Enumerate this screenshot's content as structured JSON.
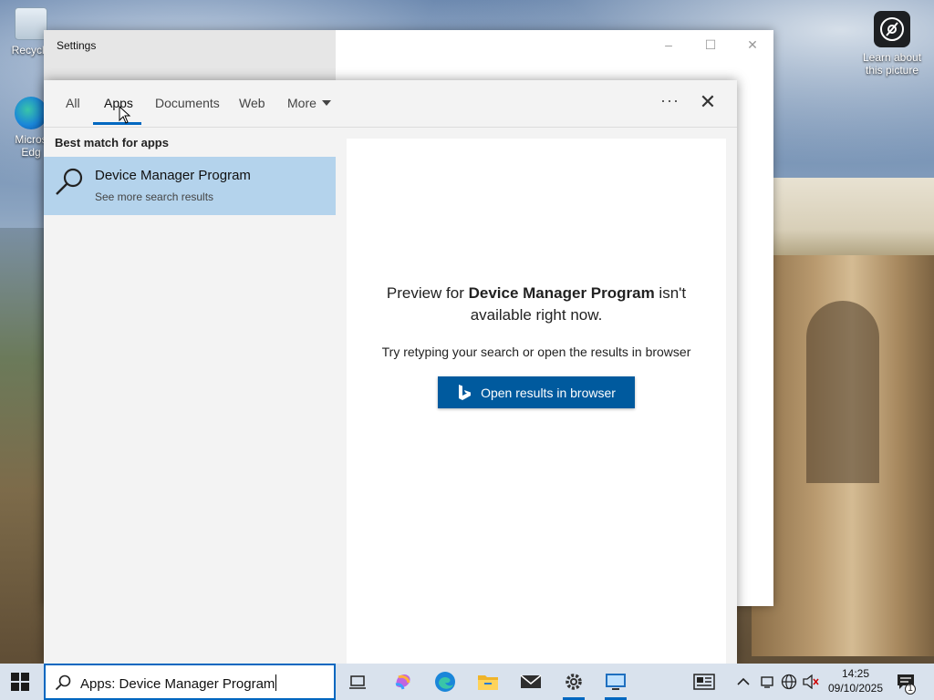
{
  "desktop": {
    "icons": [
      {
        "label": "Recycle",
        "icon": "recycle-bin-icon"
      },
      {
        "label": "Micros Edg",
        "icon": "edge-icon"
      },
      {
        "label": "Learn about this picture",
        "icon": "camera-icon"
      }
    ]
  },
  "settings_window": {
    "title": "Settings",
    "controls": {
      "minimize": "–",
      "maximize": "☐",
      "close": "✕"
    }
  },
  "search_panel": {
    "tabs": [
      {
        "label": "All"
      },
      {
        "label": "Apps",
        "active": true
      },
      {
        "label": "Documents"
      },
      {
        "label": "Web"
      },
      {
        "label": "More"
      }
    ],
    "options_label": "···",
    "close_label": "✕",
    "best_match_header": "Best match for apps",
    "best_match": {
      "title": "Device Manager Program",
      "subtitle": "See more search results"
    },
    "preview": {
      "msg_prefix": "Preview for ",
      "msg_bold": "Device Manager Program",
      "msg_suffix": " isn't available right now.",
      "hint": "Try retyping your search or open the results in browser",
      "button_label": "Open results in browser"
    }
  },
  "taskbar": {
    "search_text": "Apps: Device Manager Program",
    "pinned": [
      {
        "icon": "task-view-icon"
      },
      {
        "icon": "copilot-icon"
      },
      {
        "icon": "edge-icon"
      },
      {
        "icon": "file-explorer-icon"
      },
      {
        "icon": "mail-icon"
      },
      {
        "icon": "settings-icon",
        "active": true
      },
      {
        "icon": "remote-app-icon",
        "active": true
      }
    ],
    "clock": {
      "time": "14:25",
      "date": "09/10/2025"
    },
    "notification_count": "1"
  },
  "colors": {
    "accent": "#0067c0",
    "selected_result": "#b4d3ec",
    "button": "#005a9e"
  }
}
